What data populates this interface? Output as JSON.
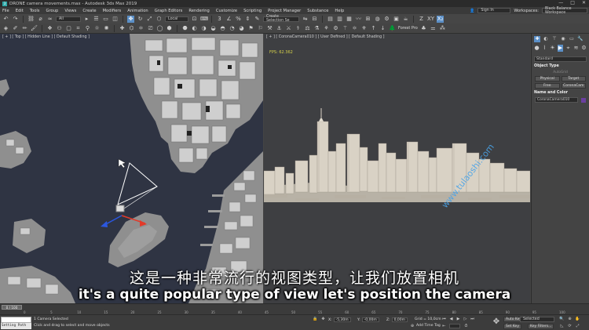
{
  "window": {
    "title": "DRONE camera movements.max - Autodesk 3ds Max 2019",
    "controls": [
      "—",
      "□",
      "✕"
    ]
  },
  "menubar": {
    "items": [
      "File",
      "Edit",
      "Tools",
      "Group",
      "Views",
      "Create",
      "Modifiers",
      "Animation",
      "Graph Editors",
      "Rendering",
      "Customize",
      "Scripting",
      "Project Manager",
      "Substance",
      "Help"
    ],
    "sign_in": "Sign In",
    "workspaces_label": "Workspaces:",
    "workspace_value": "Black Balance Workspace"
  },
  "toolbar": {
    "filter_value": "All",
    "coord_system": "Local",
    "selection_set": "Create Selection Se",
    "forest_pack": "Forest Pro"
  },
  "viewports": {
    "left_label": "[ + ] [ Top ] [ Hidden Line ] [ Default Shading ]",
    "right_label": "[ + ] [ CoronaCamera010 ] [ User Defined ] [ Default Shading ]",
    "fps_label": "FPS:",
    "fps_value": "62.362"
  },
  "command_panel": {
    "category": "Standard",
    "object_type_title": "Object Type",
    "autogrid": "AutoGrid",
    "buttons": [
      "Physical",
      "Target",
      "Free",
      "CoronaCam"
    ],
    "name_color_title": "Name and Color",
    "object_name": "CoronaCamera010"
  },
  "timeline": {
    "frame_indicator": "0 / 100",
    "ticks": [
      "0",
      "5",
      "10",
      "15",
      "20",
      "25",
      "30",
      "35",
      "40",
      "45",
      "50",
      "55",
      "60",
      "65",
      "70",
      "75",
      "80",
      "85",
      "90",
      "95",
      "100"
    ]
  },
  "statusbar": {
    "maxscript_output": "Setting Path",
    "selection_status": "1 Camera Selected",
    "prompt": "Click and drag to select and move objects",
    "x_label": "X:",
    "x_value": "-5,30m",
    "y_label": "Y:",
    "y_value": "-0,00m",
    "z_label": "Z:",
    "z_value": "0,00m",
    "grid_label": "Grid = 10,0cm",
    "add_time_tag": "Add Time Tag",
    "auto_key": "Auto Key",
    "set_key": "Set Key",
    "selected_value": "Selected",
    "key_filters": "Key Filters..."
  },
  "subtitles": {
    "chinese": "这是一种非常流行的视图类型，让我们放置相机",
    "english": "it's a quite popular type of view let's position the camera"
  },
  "watermark": "www.tulaoshi.com",
  "colors": {
    "top_view_water": "#2f3443",
    "land": "#8f8f8f",
    "buildings": "#cfc8bb",
    "accent_blue": "#5b8fc7",
    "fps_yellow": "#d8d34a",
    "watermark_blue": "#4aa3e8"
  }
}
